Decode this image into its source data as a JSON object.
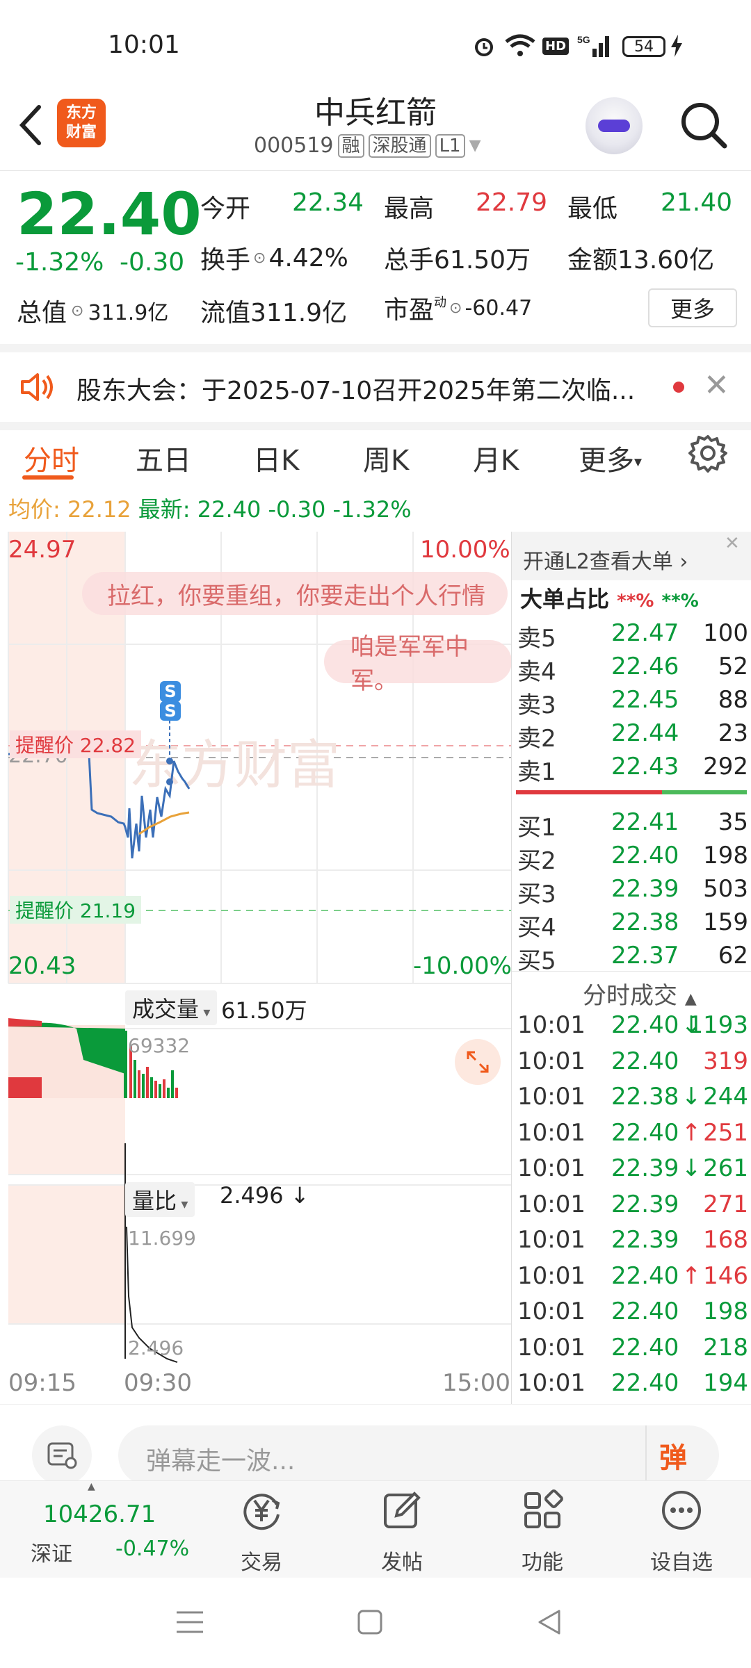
{
  "status_bar": {
    "time": "10:01",
    "battery": "54"
  },
  "header": {
    "logo_line1": "东方",
    "logo_line2": "财富",
    "title": "中兵红箭",
    "code": "000519",
    "tag_rong": "融",
    "tag_sgt": "深股通",
    "tag_level": "L1"
  },
  "quote": {
    "price": "22.40",
    "change_pct": "-1.32%",
    "change": "-0.30",
    "open_label": "今开",
    "open": "22.34",
    "high_label": "最高",
    "high": "22.79",
    "low_label": "最低",
    "low": "21.40",
    "turnover_label": "换手",
    "turnover": "4.42%",
    "volume_label": "总手",
    "volume": "61.50万",
    "amount_label": "金额",
    "amount": "13.60亿",
    "total_cap_label": "总值",
    "total_cap": "311.9亿",
    "float_cap_label": "流值",
    "float_cap": "311.9亿",
    "pe_label": "市盈",
    "pe_sup": "动",
    "pe": "-60.47",
    "more_button": "更多"
  },
  "notice": {
    "text": "股东大会：于2025-07-10召开2025年第二次临..."
  },
  "tabs": [
    "分时",
    "五日",
    "日K",
    "周K",
    "月K",
    "更多"
  ],
  "avg_line": {
    "avg_label": "均价:",
    "avg": "22.12",
    "latest_label": "最新:",
    "latest": "22.40",
    "change": "-0.30",
    "change_pct": "-1.32%"
  },
  "chart": {
    "top_price": "24.97",
    "top_pct": "10.00%",
    "bottom_price": "20.43",
    "bottom_pct": "-10.00%",
    "prev_close": "22.70",
    "alert_high": "提醒价 22.82",
    "alert_low": "提醒价 21.19",
    "danmu1": "拉红，你要重组，你要走出个人行情",
    "danmu2": "咱是军军中军。",
    "watermark": "东方财富",
    "s_label": "S",
    "volume_label": "成交量",
    "volume_total": "61.50万",
    "volume_max": "69332",
    "ratio_label": "量比",
    "ratio_value": "2.496",
    "ratio_arrow": "↓",
    "ratio_max": "11.699",
    "ratio_cur": "2.496",
    "time_start": "09:15",
    "time_mid": "09:30",
    "time_end": "15:00"
  },
  "orderbook": {
    "l2_link": "开通L2查看大单",
    "big_order_label": "大单占比",
    "big_order_red": "**%",
    "big_order_green": "**%",
    "asks": [
      {
        "label": "卖5",
        "price": "22.47",
        "vol": "100"
      },
      {
        "label": "卖4",
        "price": "22.46",
        "vol": "52"
      },
      {
        "label": "卖3",
        "price": "22.45",
        "vol": "88"
      },
      {
        "label": "卖2",
        "price": "22.44",
        "vol": "23"
      },
      {
        "label": "卖1",
        "price": "22.43",
        "vol": "292"
      }
    ],
    "bids": [
      {
        "label": "买1",
        "price": "22.41",
        "vol": "35"
      },
      {
        "label": "买2",
        "price": "22.40",
        "vol": "198"
      },
      {
        "label": "买3",
        "price": "22.39",
        "vol": "503"
      },
      {
        "label": "买4",
        "price": "22.38",
        "vol": "159"
      },
      {
        "label": "买5",
        "price": "22.37",
        "vol": "62"
      }
    ],
    "ticks_title": "分时成交",
    "ticks": [
      {
        "time": "10:01",
        "price": "22.40",
        "arrow": "↓",
        "vol": "1193",
        "color": "green"
      },
      {
        "time": "10:01",
        "price": "22.40",
        "arrow": "",
        "vol": "319",
        "color": "red"
      },
      {
        "time": "10:01",
        "price": "22.38",
        "arrow": "↓",
        "vol": "244",
        "color": "green"
      },
      {
        "time": "10:01",
        "price": "22.40",
        "arrow": "↑",
        "vol": "251",
        "color": "red"
      },
      {
        "time": "10:01",
        "price": "22.39",
        "arrow": "↓",
        "vol": "261",
        "color": "green"
      },
      {
        "time": "10:01",
        "price": "22.39",
        "arrow": "",
        "vol": "271",
        "color": "red"
      },
      {
        "time": "10:01",
        "price": "22.39",
        "arrow": "",
        "vol": "168",
        "color": "red"
      },
      {
        "time": "10:01",
        "price": "22.40",
        "arrow": "↑",
        "vol": "146",
        "color": "red"
      },
      {
        "time": "10:01",
        "price": "22.40",
        "arrow": "",
        "vol": "198",
        "color": "green"
      },
      {
        "time": "10:01",
        "price": "22.40",
        "arrow": "",
        "vol": "218",
        "color": "green"
      },
      {
        "time": "10:01",
        "price": "22.40",
        "arrow": "",
        "vol": "194",
        "color": "green"
      }
    ]
  },
  "input": {
    "placeholder": "弹幕走一波...",
    "send_label": "弹"
  },
  "bottom_nav": {
    "index_value": "10426.71",
    "index_name": "深证",
    "index_change": "-0.47%",
    "items": [
      "交易",
      "发帖",
      "功能",
      "设自选"
    ]
  },
  "colors": {
    "up": "#e0393e",
    "down": "#0a9a3a",
    "accent": "#f05a1c"
  }
}
